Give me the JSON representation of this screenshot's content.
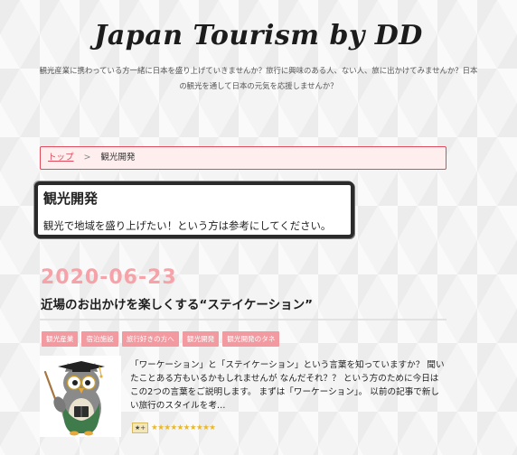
{
  "site": {
    "title": "Japan Tourism by DD",
    "tagline": "観光産業に携わっている方一緒に日本を盛り上げていきませんか？旅行に興味のある人、ない人、旅に出かけてみませんか？日本の観光を通して日本の元気を応援しませんか？"
  },
  "breadcrumb": {
    "home": "トップ",
    "separator": ">",
    "current": "観光開発"
  },
  "category": {
    "title": "観光開発",
    "description": "観光で地域を盛り上げたい！という方は参考にしてください。"
  },
  "post": {
    "date": "2020-06-23",
    "title": "近場のお出かけを楽しくする“ステイケーション”",
    "tags": [
      "観光産業",
      "宿泊施設",
      "旅行好きの方へ",
      "観光開発",
      "観光開発のタネ"
    ],
    "excerpt": "「ワーケーション」と「ステイケーション」という言葉を知っていますか？ 聞いたことある方もいるかもしれませんが なんだそれ？？ という方のために今日はこの2つの言葉をご説明します。 まずは「ワーケーション」。 以前の記事で新しい旅行のスタイルを考…",
    "rating_badge": "★+",
    "rating_stars": "★★★★★★★★★★"
  },
  "colors": {
    "accent_pink": "#f29aa0",
    "date_pink": "#f5a3a8",
    "breadcrumb_border": "#e04a5a"
  }
}
